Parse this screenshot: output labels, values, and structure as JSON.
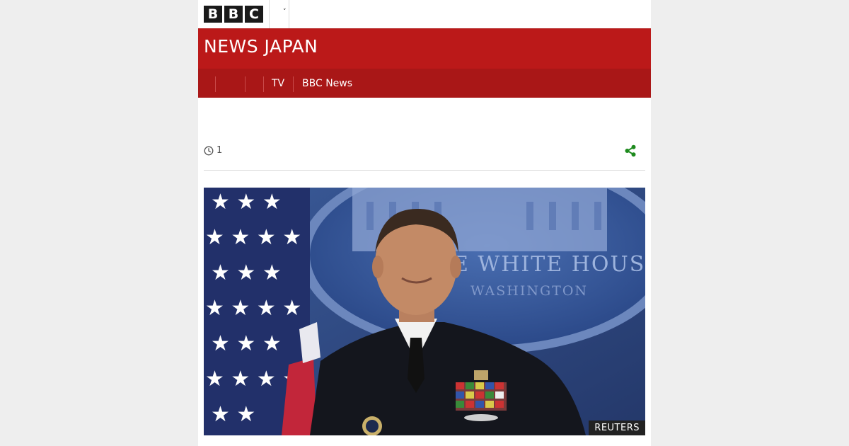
{
  "header": {
    "logo_letters": [
      "B",
      "B",
      "C"
    ],
    "logo_label": "BBC",
    "menu_icon": "chevron-down-icon"
  },
  "masthead": {
    "title_bold": "NEWS",
    "title_light": "JAPAN"
  },
  "nav": {
    "items": [
      {
        "label": ""
      },
      {
        "label": ""
      },
      {
        "label": "TV"
      },
      {
        "label": "BBC News"
      }
    ]
  },
  "article": {
    "timestamp_icon": "clock-icon",
    "timestamp_value": "1",
    "share_icon": "share-icon"
  },
  "image": {
    "credit": "REUTERS",
    "background_text_line1": "THE WHITE HOUSE",
    "background_text_line2": "WASHINGTON"
  },
  "colors": {
    "brand_red": "#bb1919",
    "nav_red": "#a91717",
    "share_green": "#1d8a1d"
  }
}
